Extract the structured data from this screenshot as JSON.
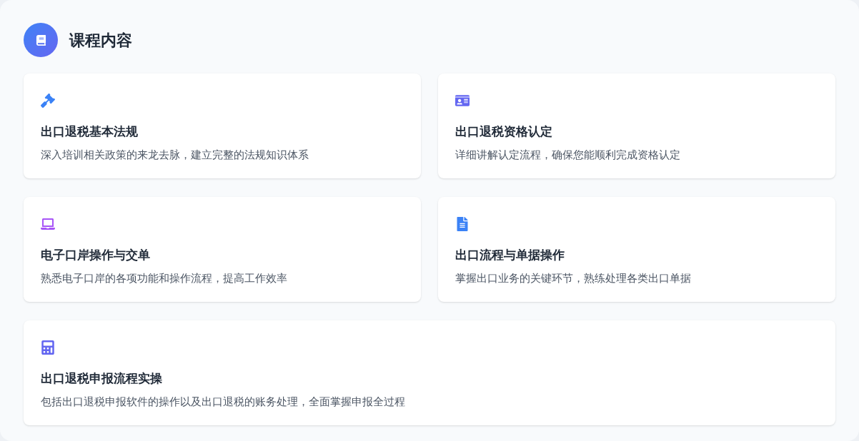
{
  "section": {
    "title": "课程内容"
  },
  "courses": [
    {
      "kind": "gavel",
      "color": "#3b82f6",
      "title": "出口退税基本法规",
      "description": "深入培训相关政策的来龙去脉，建立完整的法规知识体系"
    },
    {
      "kind": "id-card",
      "color": "#6366f1",
      "title": "出口退税资格认定",
      "description": "详细讲解认定流程，确保您能顺利完成资格认定"
    },
    {
      "kind": "laptop",
      "color": "#a855f7",
      "title": "电子口岸操作与交单",
      "description": "熟悉电子口岸的各项功能和操作流程，提高工作效率"
    },
    {
      "kind": "document",
      "color": "#3b82f6",
      "title": "出口流程与单据操作",
      "description": "掌握出口业务的关键环节，熟练处理各类出口单据"
    },
    {
      "kind": "calculator",
      "color": "#6366f1",
      "title": "出口退税申报流程实操",
      "description": "包括出口退税申报软件的操作以及出口退税的账务处理，全面掌握申报全过程"
    }
  ]
}
